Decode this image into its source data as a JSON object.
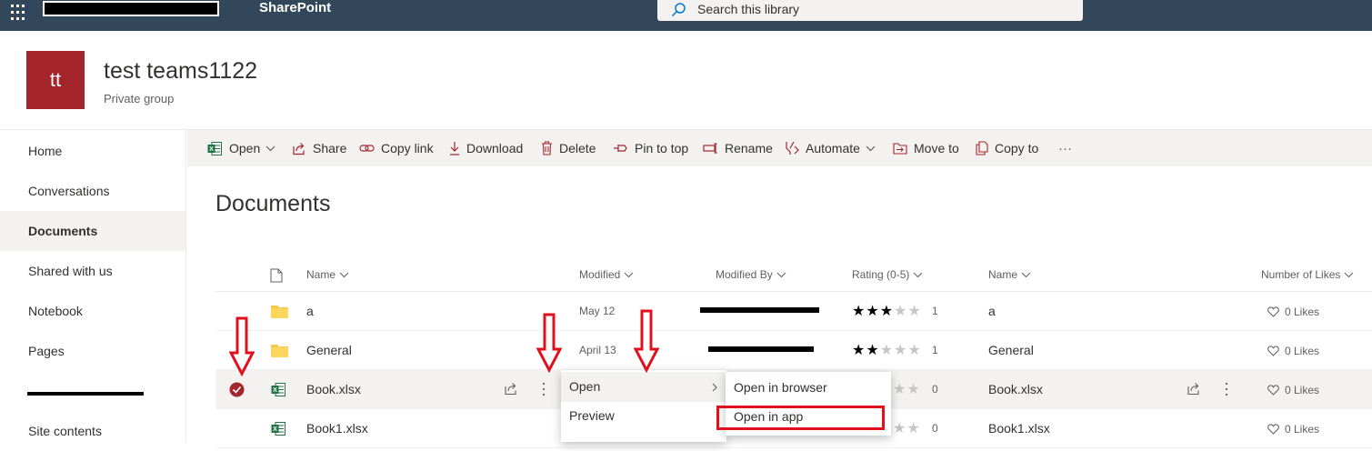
{
  "topbar": {
    "brand": "SharePoint",
    "search_placeholder": "Search this library"
  },
  "site": {
    "logo_initials": "tt",
    "title": "test teams1122",
    "subtitle": "Private group"
  },
  "nav": {
    "items": [
      {
        "label": "Home"
      },
      {
        "label": "Conversations"
      },
      {
        "label": "Documents",
        "selected": true
      },
      {
        "label": "Shared with us"
      },
      {
        "label": "Notebook"
      },
      {
        "label": "Pages"
      },
      {
        "label": ""
      },
      {
        "label": "Site contents"
      }
    ]
  },
  "commands": {
    "open": "Open",
    "share": "Share",
    "copy_link": "Copy link",
    "download": "Download",
    "delete": "Delete",
    "pin_to_top": "Pin to top",
    "rename": "Rename",
    "automate": "Automate",
    "move_to": "Move to",
    "copy_to": "Copy to",
    "more": "···"
  },
  "library": {
    "title": "Documents",
    "columns": {
      "name": "Name",
      "modified": "Modified",
      "modified_by": "Modified By",
      "rating": "Rating (0-5)",
      "name2": "Name",
      "likes": "Number of Likes"
    },
    "rows": [
      {
        "name": "a",
        "type": "folder",
        "modified": "May 12",
        "rating_stars": 3,
        "rating_count": "1",
        "name2": "a",
        "likes": "0 Likes"
      },
      {
        "name": "General",
        "type": "folder",
        "modified": "April 13",
        "rating_stars": 2,
        "rating_count": "1",
        "name2": "General",
        "likes": "0 Likes"
      },
      {
        "name": "Book.xlsx",
        "type": "excel",
        "selected": true,
        "rating_count": "0",
        "name2": "Book.xlsx",
        "likes": "0 Likes"
      },
      {
        "name": "Book1.xlsx",
        "type": "excel",
        "rating_count": "0",
        "name2": "Book1.xlsx",
        "likes": "0 Likes"
      }
    ]
  },
  "context_menu": {
    "items": [
      "Open",
      "Preview"
    ],
    "submenu": [
      "Open in browser",
      "Open in app"
    ]
  },
  "colors": {
    "topbar": "#33475b",
    "accent": "#a4262c",
    "annotation": "#e0101e"
  }
}
